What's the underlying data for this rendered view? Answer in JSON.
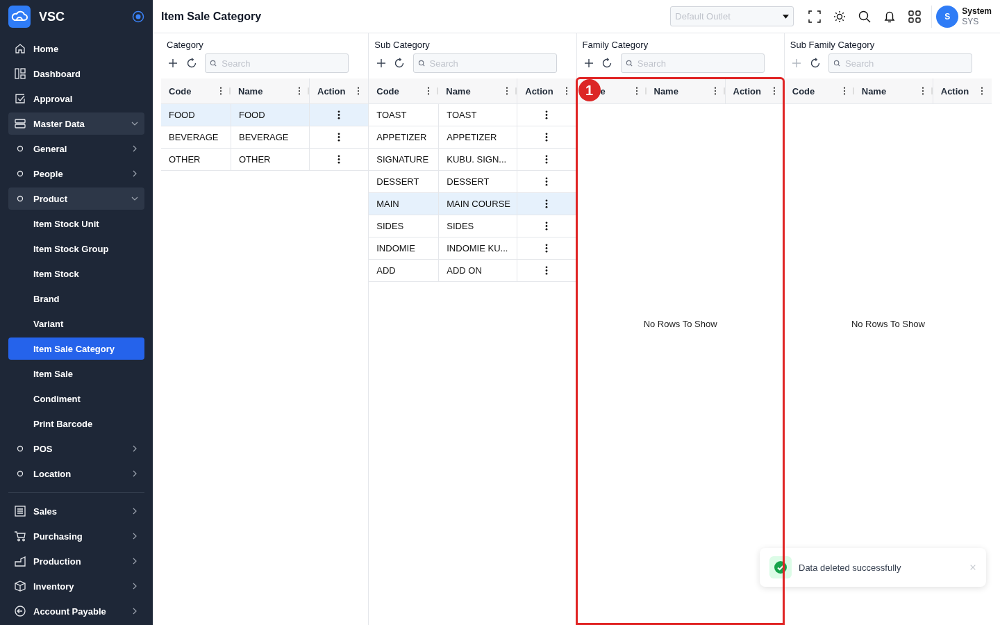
{
  "brand": {
    "name": "VSC"
  },
  "sidebar": {
    "groups": [
      [
        {
          "label": "Home",
          "kind": "icon",
          "selected": false
        },
        {
          "label": "Dashboard",
          "kind": "icon",
          "selected": false
        },
        {
          "label": "Approval",
          "kind": "icon",
          "selected": false
        },
        {
          "label": "Master Data",
          "kind": "icon",
          "selected": false,
          "expanded": true,
          "children": [
            {
              "label": "General",
              "kind": "dot",
              "selected": false,
              "expanded": false
            },
            {
              "label": "People",
              "kind": "dot",
              "selected": false,
              "expanded": false
            },
            {
              "label": "Product",
              "kind": "dot",
              "selected": false,
              "expanded": true,
              "children": [
                {
                  "label": "Item Stock Unit",
                  "kind": "plain",
                  "selected": false
                },
                {
                  "label": "Item Stock Group",
                  "kind": "plain",
                  "selected": false
                },
                {
                  "label": "Item Stock",
                  "kind": "plain",
                  "selected": false
                },
                {
                  "label": "Brand",
                  "kind": "plain",
                  "selected": false
                },
                {
                  "label": "Variant",
                  "kind": "plain",
                  "selected": false
                },
                {
                  "label": "Item Sale Category",
                  "kind": "plain",
                  "selected": true
                },
                {
                  "label": "Item Sale",
                  "kind": "plain",
                  "selected": false
                },
                {
                  "label": "Condiment",
                  "kind": "plain",
                  "selected": false
                },
                {
                  "label": "Print Barcode",
                  "kind": "plain",
                  "selected": false
                }
              ]
            },
            {
              "label": "POS",
              "kind": "dot",
              "selected": false,
              "expanded": false
            },
            {
              "label": "Location",
              "kind": "dot",
              "selected": false,
              "expanded": false
            }
          ]
        }
      ],
      [
        {
          "label": "Sales",
          "kind": "icon",
          "selected": false,
          "expanded": false
        },
        {
          "label": "Purchasing",
          "kind": "icon",
          "selected": false,
          "expanded": false
        },
        {
          "label": "Production",
          "kind": "icon",
          "selected": false,
          "expanded": false
        },
        {
          "label": "Inventory",
          "kind": "icon",
          "selected": false,
          "expanded": false
        },
        {
          "label": "Account Payable",
          "kind": "icon",
          "selected": false,
          "expanded": false
        }
      ]
    ]
  },
  "header": {
    "title": "Item Sale Category",
    "outlet_select": {
      "placeholder": "Default Outlet"
    },
    "user": {
      "initial": "S",
      "name": "System",
      "code": "SYS"
    }
  },
  "panels": [
    {
      "title": "Category",
      "add_disabled": false,
      "search": {
        "placeholder": "Search"
      },
      "columns": [
        "Code",
        "Name",
        "Action"
      ],
      "rows": [
        {
          "code": "FOOD",
          "name": "FOOD",
          "selected": true
        },
        {
          "code": "BEVERAGE",
          "name": "BEVERAGE",
          "selected": false
        },
        {
          "code": "OTHER",
          "name": "OTHER",
          "selected": false
        }
      ]
    },
    {
      "title": "Sub Category",
      "add_disabled": false,
      "search": {
        "placeholder": "Search"
      },
      "columns": [
        "Code",
        "Name",
        "Action"
      ],
      "rows": [
        {
          "code": "TOAST",
          "name": "TOAST",
          "selected": false
        },
        {
          "code": "APPETIZER",
          "name": "APPETIZER",
          "selected": false
        },
        {
          "code": "SIGNATURE",
          "name": "KUBU. SIGN...",
          "selected": false
        },
        {
          "code": "DESSERT",
          "name": "DESSERT",
          "selected": false
        },
        {
          "code": "MAIN",
          "name": "MAIN COURSE",
          "selected": true
        },
        {
          "code": "SIDES",
          "name": "SIDES",
          "selected": false
        },
        {
          "code": "INDOMIE",
          "name": "INDOMIE KU...",
          "selected": false
        },
        {
          "code": "ADD",
          "name": "ADD ON",
          "selected": false
        }
      ]
    },
    {
      "title": "Family Category",
      "add_disabled": false,
      "search": {
        "placeholder": "Search"
      },
      "columns": [
        "e",
        "Name",
        "Action"
      ],
      "empty_text": "No Rows To Show",
      "annotation": {
        "label": "1"
      }
    },
    {
      "title": "Sub Family Category",
      "add_disabled": true,
      "search": {
        "placeholder": "Search"
      },
      "columns": [
        "Code",
        "Name",
        "Action"
      ],
      "empty_text": "No Rows To Show"
    }
  ],
  "toast": {
    "message": "Data deleted successfully"
  }
}
